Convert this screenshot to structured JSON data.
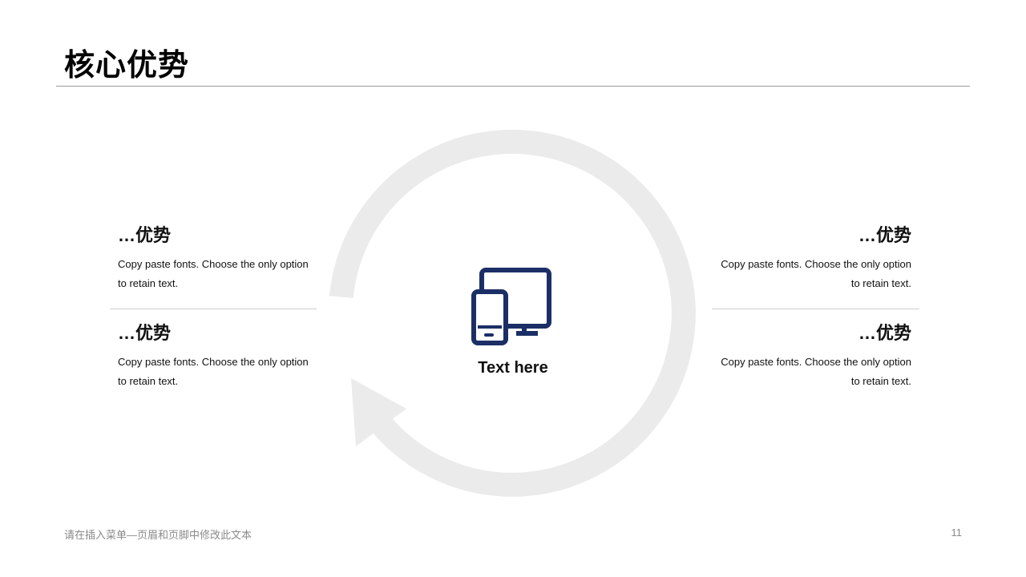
{
  "header": {
    "title": "核心优势"
  },
  "center": {
    "icon": "devices-icon",
    "label": "Text here"
  },
  "features": [
    {
      "heading": "…优势",
      "body": "Copy paste fonts. Choose the only option to retain text."
    },
    {
      "heading": "…优势",
      "body": "Copy paste fonts. Choose the only option to retain text."
    },
    {
      "heading": "…优势",
      "body": "Copy paste fonts. Choose the only option to retain text."
    },
    {
      "heading": "…优势",
      "body": "Copy paste fonts. Choose the only option to retain text."
    }
  ],
  "footer": {
    "text": "请在插入菜单—页眉和页脚中修改此文本",
    "page_number": "11"
  },
  "colors": {
    "accent": "#1b2f66",
    "ring": "#ebebeb",
    "rule": "#9a9a9a",
    "footer": "#8a8a8a"
  }
}
